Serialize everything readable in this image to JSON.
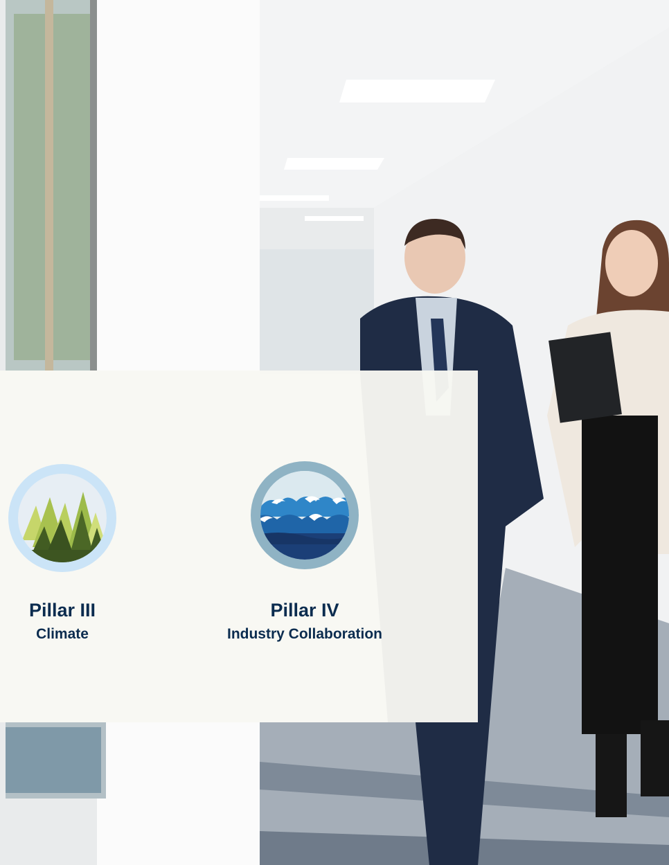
{
  "pillars": [
    {
      "title": "Pillar III",
      "subtitle": "Climate",
      "icon": "forest-icon"
    },
    {
      "title": "Pillar IV",
      "subtitle": "Industry Collaboration",
      "icon": "waves-icon"
    }
  ],
  "colors": {
    "title": "#0b2c4f",
    "card_background": "#f8f8f2",
    "climate_ring": "#cbe4f7",
    "collaboration_ring": "#8fb3c4"
  }
}
